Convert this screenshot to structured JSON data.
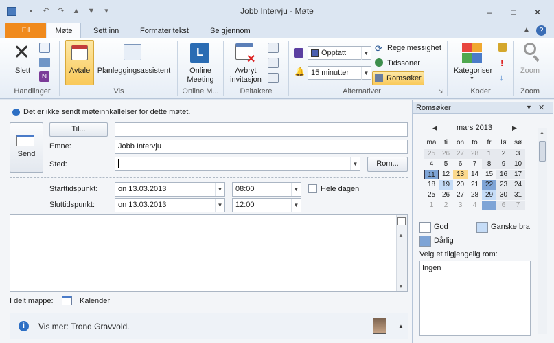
{
  "window": {
    "title": "Jobb Intervju - Møte"
  },
  "tabs": [
    {
      "label": "Fil"
    },
    {
      "label": "Møte"
    },
    {
      "label": "Sett inn"
    },
    {
      "label": "Formater tekst"
    },
    {
      "label": "Se gjennom"
    }
  ],
  "ribbon": {
    "handlinger": {
      "delete": "Slett",
      "group": "Handlinger"
    },
    "vis": {
      "avtale": "Avtale",
      "planlegging": "Planleggingsassistent",
      "group": "Vis"
    },
    "online": {
      "l1": "Online",
      "l2": "Meeting",
      "group": "Online M..."
    },
    "deltakere": {
      "l1": "Avbryt",
      "l2": "invitasjon",
      "group": "Deltakere"
    },
    "alternativer": {
      "showas": "Opptatt",
      "reminder": "15 minutter",
      "recurrence": "Regelmessighet",
      "timezones": "Tidssoner",
      "roomfinder": "Romsøker",
      "group": "Alternativer"
    },
    "koder": {
      "categorize": "Kategoriser",
      "group": "Koder"
    },
    "zoom": {
      "label": "Zoom",
      "group": "Zoom"
    }
  },
  "form": {
    "info": "Det er ikke sendt møteinnkallelser for dette møtet.",
    "send": "Send",
    "to_button": "Til...",
    "to_value": "",
    "subject_label": "Emne:",
    "subject_value": "Jobb Intervju",
    "location_label": "Sted:",
    "location_value": "",
    "rooms_button": "Rom...",
    "start_label": "Starttidspunkt:",
    "start_date": "on 13.03.2013",
    "start_time": "08:00",
    "allday": "Hele dagen",
    "end_label": "Sluttidspunkt:",
    "end_date": "on 13.03.2013",
    "end_time": "12:00",
    "folder_label": "I delt mappe:",
    "folder_value": "Kalender",
    "people": "Vis mer: Trond Gravvold."
  },
  "pane": {
    "title": "Romsøker",
    "month": "mars 2013",
    "weekdays": [
      "ma",
      "ti",
      "on",
      "to",
      "fr",
      "lø",
      "sø"
    ],
    "weeks": [
      [
        "25",
        "26",
        "27",
        "28",
        "1",
        "2",
        "3"
      ],
      [
        "4",
        "5",
        "6",
        "7",
        "8",
        "9",
        "10"
      ],
      [
        "11",
        "12",
        "13",
        "14",
        "15",
        "16",
        "17"
      ],
      [
        "18",
        "19",
        "20",
        "21",
        "22",
        "23",
        "24"
      ],
      [
        "25",
        "26",
        "27",
        "28",
        "29",
        "30",
        "31"
      ],
      [
        "1",
        "2",
        "3",
        "4",
        "5",
        "6",
        "7"
      ]
    ],
    "legend_good": "God",
    "legend_fair": "Ganske bra",
    "legend_poor": "Dårlig",
    "room_label": "Velg et tilgjengelig rom:",
    "room_value": "Ingen"
  },
  "colors": {
    "accent": "#f08a1c",
    "selected": "#fbd98d",
    "today": "#7fa8d8",
    "good": "#ffffff",
    "fair": "#c5dcf7",
    "poor": "#7ea4d6"
  }
}
